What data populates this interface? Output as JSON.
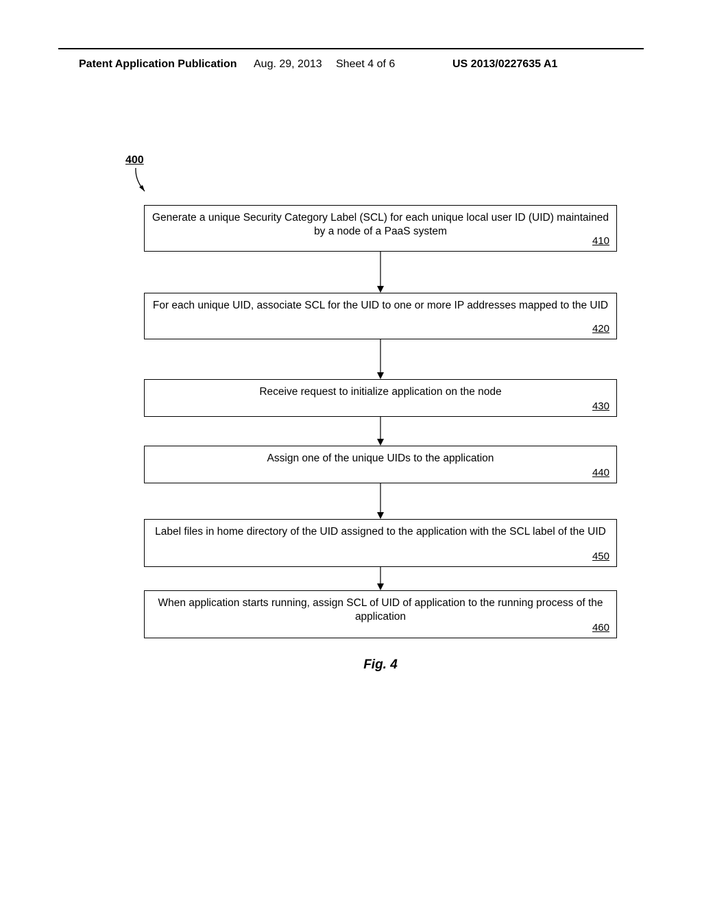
{
  "header": {
    "title": "Patent Application Publication",
    "date": "Aug. 29, 2013",
    "sheet": "Sheet 4 of 6",
    "pubnum": "US 2013/0227635 A1"
  },
  "figure_ref": "400",
  "figure_caption": "Fig. 4",
  "steps": [
    {
      "num": "410",
      "text": "Generate a unique Security Category Label (SCL) for each unique local user ID (UID) maintained by a node of a PaaS system"
    },
    {
      "num": "420",
      "text": "For each unique UID, associate SCL for the UID to one or more IP addresses mapped to the UID"
    },
    {
      "num": "430",
      "text": "Receive request to initialize application on the node"
    },
    {
      "num": "440",
      "text": "Assign one of the unique UIDs to the application"
    },
    {
      "num": "450",
      "text": "Label files in home directory of the UID assigned to the application with the SCL label of the UID"
    },
    {
      "num": "460",
      "text": "When application starts running, assign SCL of UID of application to the running process of the application"
    }
  ],
  "connector_heights": [
    60,
    58,
    42,
    52,
    34
  ]
}
